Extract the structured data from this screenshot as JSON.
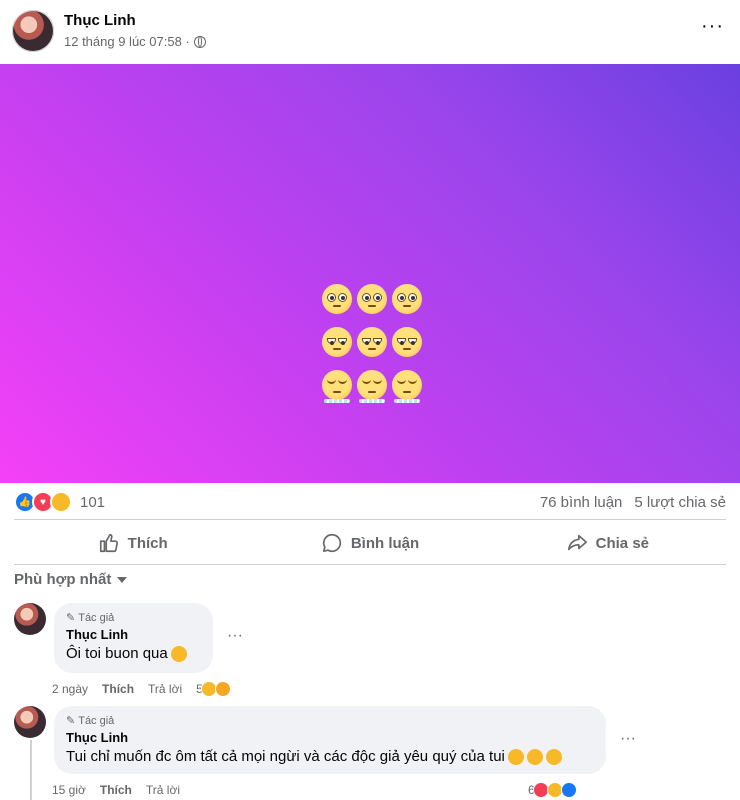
{
  "post": {
    "author": "Thục Linh",
    "meta": "12 tháng 9 lúc 07:58 ·",
    "more": "···"
  },
  "stats": {
    "reaction_count": "101",
    "comments": "76 bình luận",
    "shares": "5 lượt chia sẻ"
  },
  "actions": {
    "like": "Thích",
    "comment": "Bình luận",
    "share": "Chia sẻ"
  },
  "sort_label": "Phù hợp nhất",
  "comments": [
    {
      "badge": "Tác giả",
      "name": "Thục Linh",
      "text": "Ôi toi buon qua",
      "time": "2 ngày",
      "like": "Thích",
      "reply": "Trả lời",
      "reaction_count": "5"
    },
    {
      "badge": "Tác giả",
      "name": "Thục Linh",
      "text": "Tui chỉ muốn đc ôm tất cả mọi ngừi và các độc giả yêu quý của tui",
      "time": "15 giờ",
      "like": "Thích",
      "reply": "Trả lời",
      "reaction_count": "6"
    }
  ],
  "colors": {
    "gradient_start": "#f540f7",
    "gradient_end": "#6a40e0",
    "accent": "#1877f2"
  }
}
